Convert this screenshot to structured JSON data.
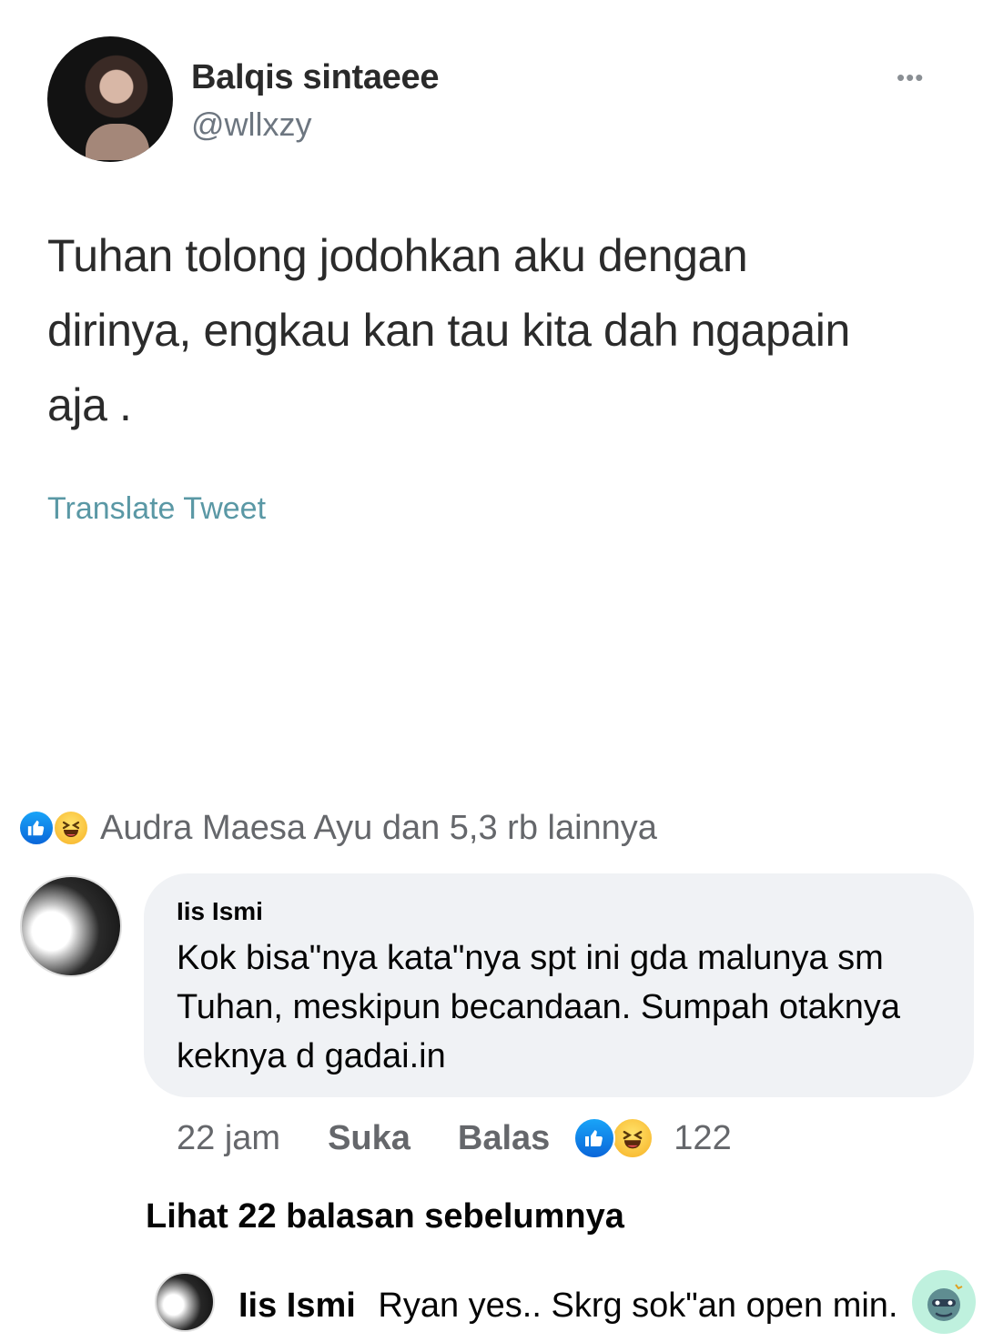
{
  "tweet": {
    "display_name": "Balqis sintaeee",
    "handle": "@wllxzy",
    "more_label": "•••",
    "text_lines": [
      "Tuhan tolong jodohkan aku dengan",
      "dirinya, engkau kan tau kita dah ngapain",
      "aja ."
    ],
    "translate_label": "Translate Tweet"
  },
  "post_reactions": {
    "icons": [
      "like-icon",
      "haha-icon"
    ],
    "summary": "Audra Maesa Ayu dan 5,3 rb lainnya"
  },
  "comment": {
    "author": "Iis Ismi",
    "body_lines": [
      "Kok bisa\"nya kata\"nya spt ini gda malunya sm",
      "Tuhan, meskipun becandaan. Sumpah otaknya",
      "keknya d gadai.in"
    ],
    "time": "22 jam",
    "like_label": "Suka",
    "reply_label": "Balas",
    "reaction_icons": [
      "like-icon",
      "haha-icon"
    ],
    "reaction_count": "122"
  },
  "view_previous_replies": "Lihat 22 balasan sebelumnya",
  "reply_preview": {
    "author": "Iis Ismi",
    "text": "Ryan yes.. Skrg sok\"an open min.",
    "sticker_icon": "sticker-icon"
  },
  "colors": {
    "link_teal": "#5a98a5",
    "fb_blue": "#0a66d9",
    "muted_gray": "#65676b",
    "bubble_bg": "#f0f2f5"
  }
}
